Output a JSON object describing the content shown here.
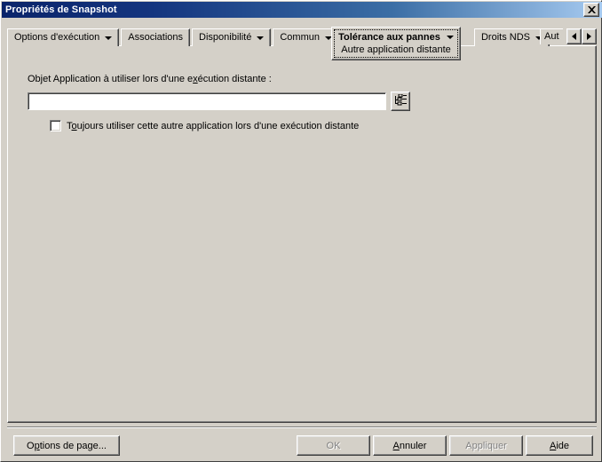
{
  "window": {
    "title": "Propriétés de Snapshot",
    "close_button": {
      "name": "close-icon",
      "label": "✕"
    }
  },
  "tabs": {
    "items": [
      {
        "label": "Options d'exécution",
        "has_dropdown": true,
        "active": false
      },
      {
        "label": "Associations",
        "has_dropdown": false,
        "active": false
      },
      {
        "label": "Disponibilité",
        "has_dropdown": true,
        "active": false
      },
      {
        "label": "Commun",
        "has_dropdown": true,
        "active": false
      },
      {
        "label": "Droits NDS",
        "has_dropdown": true,
        "active": false
      }
    ],
    "active_tab": {
      "label": "Tolérance aux pannes",
      "sublabel": "Autre application distante",
      "has_dropdown": true
    },
    "clipped_tab_label": "Aut",
    "scroll_left_label": "◀",
    "scroll_right_label": "▶"
  },
  "form": {
    "field_label_before": "Objet Application à utiliser lors d'une e",
    "field_label_accel": "x",
    "field_label_after": "écution distante :",
    "app_object_value": "",
    "app_object_placeholder": "",
    "browse_icon": "tree-browse-icon",
    "checkbox_checked": false,
    "checkbox_label_before": "T",
    "checkbox_label_accel": "o",
    "checkbox_label_after": "ujours utiliser cette autre application lors d'une exécution distante"
  },
  "footer": {
    "page_options_before": "O",
    "page_options_accel": "p",
    "page_options_after": "tions de page...",
    "ok_label": "OK",
    "ok_enabled": false,
    "cancel_before": "",
    "cancel_accel": "A",
    "cancel_after": "nnuler",
    "apply_label": "Appliquer",
    "apply_enabled": false,
    "help_before": "",
    "help_accel": "A",
    "help_after": "ide"
  },
  "colors": {
    "face": "#d4d0c8",
    "title_gradient_start": "#0a246a",
    "title_gradient_end": "#a6caf0",
    "field_bg": "#ffffff",
    "disabled_text": "#808080"
  }
}
